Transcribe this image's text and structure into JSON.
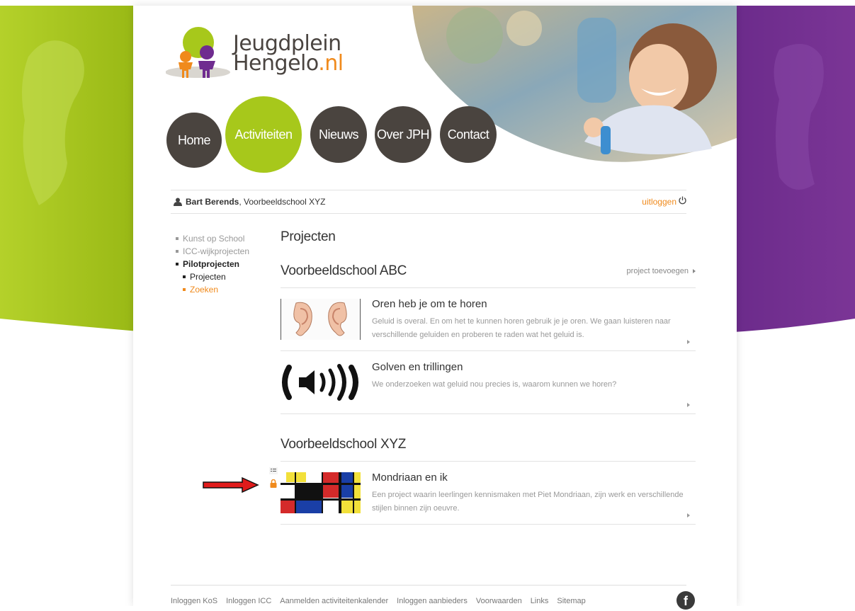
{
  "logo": {
    "line1": "Jeugdplein",
    "line2_main": "Hengelo",
    "line2_ext": ".nl"
  },
  "nav": [
    "Home",
    "Activiteiten",
    "Nieuws",
    "Over JPH",
    "Contact"
  ],
  "nav_active": "Activiteiten",
  "user": {
    "name": "Bart Berends",
    "school": ", Voorbeeldschool XYZ",
    "logout": "uitloggen"
  },
  "sidebar": {
    "items": [
      "Kunst op School",
      "ICC-wijkprojecten",
      "Pilotprojecten"
    ],
    "sub": [
      "Projecten",
      "Zoeken"
    ]
  },
  "main": {
    "title": "Projecten",
    "schools": [
      {
        "name": "Voorbeeldschool ABC",
        "add_label": "project toevoegen",
        "projects": [
          {
            "title": "Oren heb je om te horen",
            "desc": "Geluid is overal. En om het te kunnen horen gebruik je je oren. We gaan luisteren naar verschillende geluiden en proberen te raden wat het geluid is.",
            "thumb": "ears-image"
          },
          {
            "title": "Golven en trillingen",
            "desc": "We onderzoeken wat geluid nou precies is, waarom kunnen we horen?",
            "thumb": "speaker-icon"
          }
        ]
      },
      {
        "name": "Voorbeeldschool XYZ",
        "projects": [
          {
            "title": "Mondriaan en ik",
            "desc": "Een project waarin leerlingen kennismaken met Piet Mondriaan, zijn werk en verschillende stijlen binnen zijn oeuvre.",
            "thumb": "mondrian-image"
          }
        ]
      }
    ]
  },
  "footer": [
    "Inloggen KoS",
    "Inloggen ICC",
    "Aanmelden activiteitenkalender",
    "Inloggen aanbieders",
    "Voorwaarden",
    "Links",
    "Sitemap"
  ],
  "facebook": "f",
  "colors": {
    "green": "#a7c81b",
    "purple": "#6f2c8f",
    "orange": "#f08a1c",
    "dark": "#4a443f"
  }
}
